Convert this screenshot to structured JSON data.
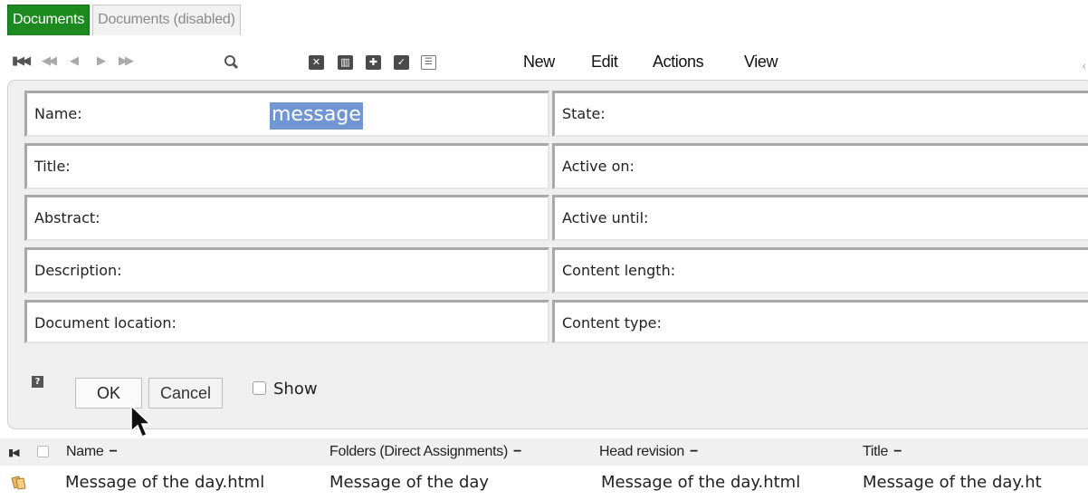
{
  "tabs": [
    {
      "label": "Documents",
      "active": true
    },
    {
      "label": "Documents (disabled)",
      "active": false
    }
  ],
  "toolbar": {
    "nav_icons": [
      "first-page-icon",
      "previous-page-icon",
      "previous-icon",
      "next-icon",
      "next-page-icon"
    ],
    "search_icon": "search-icon",
    "tool_icons": [
      "x-box-icon",
      "columns-icon",
      "cross-box-icon",
      "check-box-icon",
      "list-icon"
    ],
    "menu": [
      "New",
      "Edit",
      "Actions",
      "View"
    ]
  },
  "form": {
    "left_fields": [
      {
        "label": "Name:",
        "value": "message"
      },
      {
        "label": "Title:"
      },
      {
        "label": "Abstract:"
      },
      {
        "label": "Description:"
      },
      {
        "label": "Document location:"
      }
    ],
    "right_fields": [
      {
        "label": "State:"
      },
      {
        "label": "Active on:"
      },
      {
        "label": "Active until:"
      },
      {
        "label": "Content length:"
      },
      {
        "label": "Content type:"
      }
    ],
    "help_icon": "?",
    "ok_label": "OK",
    "cancel_label": "Cancel",
    "show_label": "Show",
    "show_checked": false
  },
  "list": {
    "columns": [
      "Name",
      "Folders (Direct Assignments)",
      "Head revision",
      "Title"
    ],
    "rows": [
      [
        "Message of the day.html",
        "Message of the day",
        "Message of the day.html",
        "Message of the day.ht"
      ]
    ]
  },
  "colors": {
    "tab_active": "#1c8a1f",
    "selection": "#7296d4",
    "panel_bg": "#efefef"
  }
}
